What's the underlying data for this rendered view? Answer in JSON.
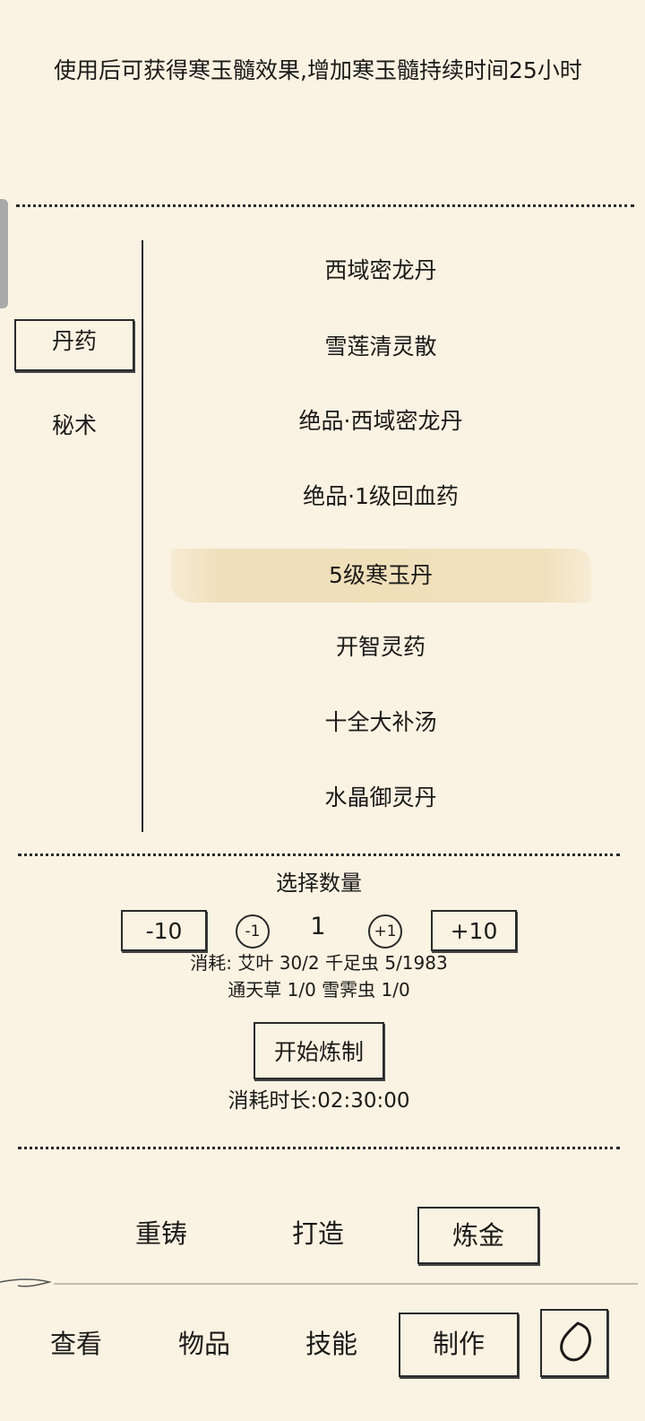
{
  "description": "使用后可获得寒玉髓效果,增加寒玉髓持续时间25小时",
  "categories": [
    {
      "label": "丹药",
      "selected": true
    },
    {
      "label": "秘术",
      "selected": false
    }
  ],
  "recipes": [
    {
      "label": "西域密龙丹",
      "selected": false
    },
    {
      "label": "雪莲清灵散",
      "selected": false
    },
    {
      "label": "绝品·西域密龙丹",
      "selected": false
    },
    {
      "label": "绝品·1级回血药",
      "selected": false
    },
    {
      "label": "5级寒玉丹",
      "selected": true
    },
    {
      "label": "开智灵药",
      "selected": false
    },
    {
      "label": "十全大补汤",
      "selected": false
    },
    {
      "label": "水晶御灵丹",
      "selected": false
    }
  ],
  "quantity": {
    "title": "选择数量",
    "minus10": "-10",
    "minus1": "-1",
    "value": "1",
    "plus1": "+1",
    "plus10": "+10"
  },
  "cost": {
    "line1": "消耗: 艾叶 30/2 千足虫 5/1983",
    "line2": "通天草 1/0 雪霁虫 1/0"
  },
  "start_button": "开始炼制",
  "duration": "消耗时长:02:30:00",
  "sub_tabs": [
    {
      "label": "重铸",
      "selected": false
    },
    {
      "label": "打造",
      "selected": false
    },
    {
      "label": "炼金",
      "selected": true
    }
  ],
  "nav_tabs": [
    {
      "label": "查看",
      "selected": false
    },
    {
      "label": "物品",
      "selected": false
    },
    {
      "label": "技能",
      "selected": false
    },
    {
      "label": "制作",
      "selected": true
    }
  ],
  "icons": {
    "back": "back-arrow-icon"
  },
  "colors": {
    "background": "#faf3e3",
    "highlight": "#efdfba",
    "ink": "#1b1a18"
  }
}
